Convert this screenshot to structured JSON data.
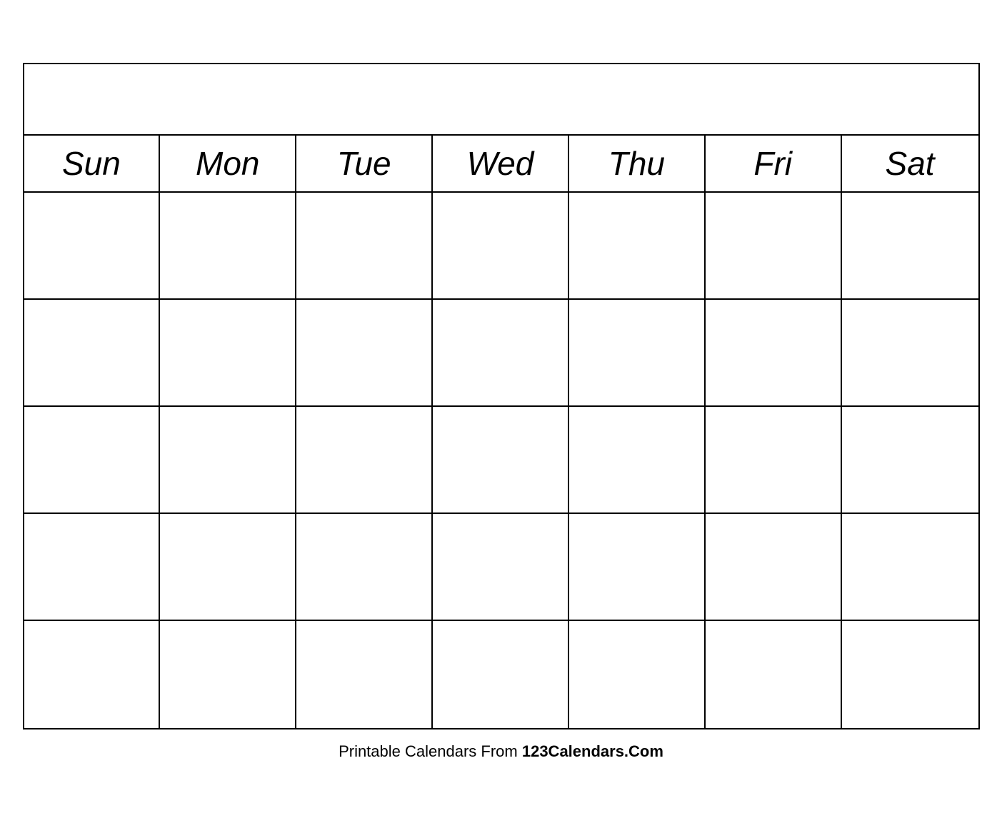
{
  "calendar": {
    "title": "",
    "days": [
      "Sun",
      "Mon",
      "Tue",
      "Wed",
      "Thu",
      "Fri",
      "Sat"
    ],
    "rows": 5,
    "cols": 7
  },
  "footer": {
    "text_normal": "Printable Calendars From ",
    "text_bold": "123Calendars.Com"
  }
}
